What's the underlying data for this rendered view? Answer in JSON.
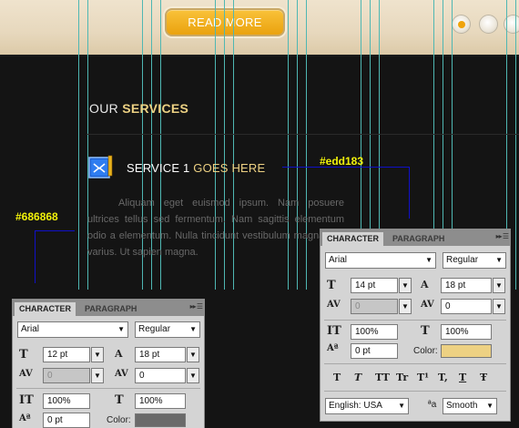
{
  "page": {
    "read_more": "READ MORE",
    "section_title": {
      "prefix": "OUR",
      "accent": "SERVICES"
    },
    "service": {
      "title_prefix": "SERVICE 1",
      "title_accent": "GOES HERE",
      "text": "Aliquam eget euismod ipsum. Nam posuere ultrices tellus sed fermentum. Nam sagittis elementum odio a elementum. Nulla tincidunt vestibulum magna nec varius. Ut sapien magna."
    },
    "annotations": {
      "title_color": "#edd183",
      "text_color": "#686868"
    },
    "slider_dots": [
      {
        "active": true
      },
      {
        "active": false
      },
      {
        "active": false
      }
    ]
  },
  "panel_left": {
    "tab_character": "CHARACTER",
    "tab_paragraph": "PARAGRAPH",
    "font_family": "Arial",
    "font_style": "Regular",
    "font_size": "12 pt",
    "leading": "18 pt",
    "kerning": "0",
    "tracking": "0",
    "vertical_scale": "100%",
    "horizontal_scale": "100%",
    "baseline_shift": "0 pt",
    "color_label": "Color:",
    "color": "#6a6a6a"
  },
  "panel_right": {
    "tab_character": "CHARACTER",
    "tab_paragraph": "PARAGRAPH",
    "font_family": "Arial",
    "font_style": "Regular",
    "font_size": "14 pt",
    "leading": "18 pt",
    "kerning": "0",
    "tracking": "0",
    "vertical_scale": "100%",
    "horizontal_scale": "100%",
    "baseline_shift": "0 pt",
    "color_label": "Color:",
    "color": "#edd183",
    "language": "English: USA",
    "aa_label": "a",
    "antialias": "Smooth",
    "style_buttons": [
      "T",
      "T",
      "TT",
      "Tr",
      "T¹",
      "T,",
      "T",
      "Ŧ"
    ]
  },
  "colors": {
    "accent_gold": "#edd183",
    "guide": "#4fb7b3",
    "button": "#f2b21e"
  }
}
